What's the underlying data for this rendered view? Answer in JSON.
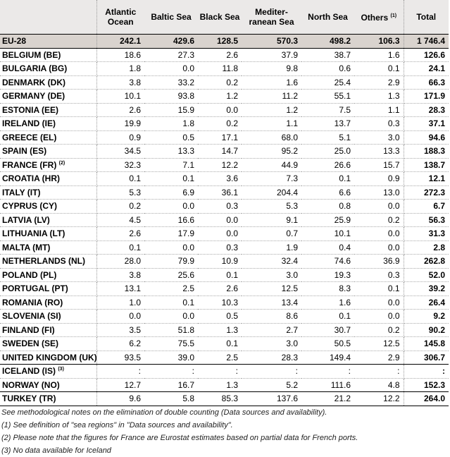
{
  "table": {
    "columns": [
      {
        "label": "",
        "note": ""
      },
      {
        "label": "Atlantic Ocean",
        "note": ""
      },
      {
        "label": "Baltic Sea",
        "note": ""
      },
      {
        "label": "Black Sea",
        "note": ""
      },
      {
        "label": "Mediter-ranean Sea",
        "note": ""
      },
      {
        "label": "North Sea",
        "note": ""
      },
      {
        "label": "Others",
        "note": "(1)"
      },
      {
        "label": "Total",
        "note": ""
      }
    ],
    "header_lines": {
      "atlantic": [
        "Atlantic",
        "Ocean"
      ],
      "baltic": "Baltic Sea",
      "black": "Black Sea",
      "med": [
        "Mediter-",
        "ranean Sea"
      ],
      "north": "North Sea",
      "others": "Others",
      "others_note": "(1)",
      "total": "Total"
    },
    "rows": [
      {
        "name": "EU-28",
        "note": "",
        "values": [
          "242.1",
          "429.6",
          "128.5",
          "570.3",
          "498.2",
          "106.3",
          "1 746.4"
        ],
        "group": "aggregate"
      },
      {
        "name": "BELGIUM (BE)",
        "note": "",
        "values": [
          "18.6",
          "27.3",
          "2.6",
          "37.9",
          "38.7",
          "1.6",
          "126.6"
        ]
      },
      {
        "name": "BULGARIA (BG)",
        "note": "",
        "values": [
          "1.8",
          "0.0",
          "11.8",
          "9.8",
          "0.6",
          "0.1",
          "24.1"
        ]
      },
      {
        "name": "DENMARK (DK)",
        "note": "",
        "values": [
          "3.8",
          "33.2",
          "0.2",
          "1.6",
          "25.4",
          "2.9",
          "66.3"
        ]
      },
      {
        "name": "GERMANY (DE)",
        "note": "",
        "values": [
          "10.1",
          "93.8",
          "1.2",
          "11.2",
          "55.1",
          "1.3",
          "171.9"
        ]
      },
      {
        "name": "ESTONIA (EE)",
        "note": "",
        "values": [
          "2.6",
          "15.9",
          "0.0",
          "1.2",
          "7.5",
          "1.1",
          "28.3"
        ]
      },
      {
        "name": "IRELAND (IE)",
        "note": "",
        "values": [
          "19.9",
          "1.8",
          "0.2",
          "1.1",
          "13.7",
          "0.3",
          "37.1"
        ]
      },
      {
        "name": "GREECE (EL)",
        "note": "",
        "values": [
          "0.9",
          "0.5",
          "17.1",
          "68.0",
          "5.1",
          "3.0",
          "94.6"
        ]
      },
      {
        "name": "SPAIN (ES)",
        "note": "",
        "values": [
          "34.5",
          "13.3",
          "14.7",
          "95.2",
          "25.0",
          "13.3",
          "188.3"
        ]
      },
      {
        "name": "FRANCE (FR)",
        "note": "(2)",
        "values": [
          "32.3",
          "7.1",
          "12.2",
          "44.9",
          "26.6",
          "15.7",
          "138.7"
        ]
      },
      {
        "name": "CROATIA (HR)",
        "note": "",
        "values": [
          "0.1",
          "0.1",
          "3.6",
          "7.3",
          "0.1",
          "0.9",
          "12.1"
        ]
      },
      {
        "name": "ITALY (IT)",
        "note": "",
        "values": [
          "5.3",
          "6.9",
          "36.1",
          "204.4",
          "6.6",
          "13.0",
          "272.3"
        ]
      },
      {
        "name": "CYPRUS (CY)",
        "note": "",
        "values": [
          "0.2",
          "0.0",
          "0.3",
          "5.3",
          "0.8",
          "0.0",
          "6.7"
        ]
      },
      {
        "name": "LATVIA (LV)",
        "note": "",
        "values": [
          "4.5",
          "16.6",
          "0.0",
          "9.1",
          "25.9",
          "0.2",
          "56.3"
        ]
      },
      {
        "name": "LITHUANIA (LT)",
        "note": "",
        "values": [
          "2.6",
          "17.9",
          "0.0",
          "0.7",
          "10.1",
          "0.0",
          "31.3"
        ]
      },
      {
        "name": "MALTA (MT)",
        "note": "",
        "values": [
          "0.1",
          "0.0",
          "0.3",
          "1.9",
          "0.4",
          "0.0",
          "2.8"
        ]
      },
      {
        "name": "NETHERLANDS (NL)",
        "note": "",
        "values": [
          "28.0",
          "79.9",
          "10.9",
          "32.4",
          "74.6",
          "36.9",
          "262.8"
        ]
      },
      {
        "name": "POLAND (PL)",
        "note": "",
        "values": [
          "3.8",
          "25.6",
          "0.1",
          "3.0",
          "19.3",
          "0.3",
          "52.0"
        ]
      },
      {
        "name": "PORTUGAL (PT)",
        "note": "",
        "values": [
          "13.1",
          "2.5",
          "2.6",
          "12.5",
          "8.3",
          "0.1",
          "39.2"
        ]
      },
      {
        "name": "ROMANIA (RO)",
        "note": "",
        "values": [
          "1.0",
          "0.1",
          "10.3",
          "13.4",
          "1.6",
          "0.0",
          "26.4"
        ]
      },
      {
        "name": "SLOVENIA (SI)",
        "note": "",
        "values": [
          "0.0",
          "0.0",
          "0.5",
          "8.6",
          "0.1",
          "0.0",
          "9.2"
        ]
      },
      {
        "name": "FINLAND (FI)",
        "note": "",
        "values": [
          "3.5",
          "51.8",
          "1.3",
          "2.7",
          "30.7",
          "0.2",
          "90.2"
        ]
      },
      {
        "name": "SWEDEN (SE)",
        "note": "",
        "values": [
          "6.2",
          "75.5",
          "0.1",
          "3.0",
          "50.5",
          "12.5",
          "145.8"
        ]
      },
      {
        "name": "UNITED KINGDOM (UK)",
        "note": "",
        "values": [
          "93.5",
          "39.0",
          "2.5",
          "28.3",
          "149.4",
          "2.9",
          "306.7"
        ]
      },
      {
        "name": "ICELAND (IS)",
        "note": "(3)",
        "values": [
          ":",
          ":",
          ":",
          ":",
          ":",
          ":",
          ":"
        ],
        "group": "efta-start"
      },
      {
        "name": "NORWAY (NO)",
        "note": "",
        "values": [
          "12.7",
          "16.7",
          "1.3",
          "5.2",
          "111.6",
          "4.8",
          "152.3"
        ]
      },
      {
        "name": "TURKEY (TR)",
        "note": "",
        "values": [
          "9.6",
          "5.8",
          "85.3",
          "137.6",
          "21.2",
          "12.2",
          "264.0"
        ],
        "group": "candidate"
      }
    ]
  },
  "notes": [
    "See methodological notes on the elimination of double counting (Data sources and availability).",
    "(1) See definition of \"sea regions\" in \"Data sources and availability\".",
    "(2) Please note that the figures for France are Eurostat estimates based on partial data for French ports.",
    "(3) No data available for Iceland"
  ]
}
